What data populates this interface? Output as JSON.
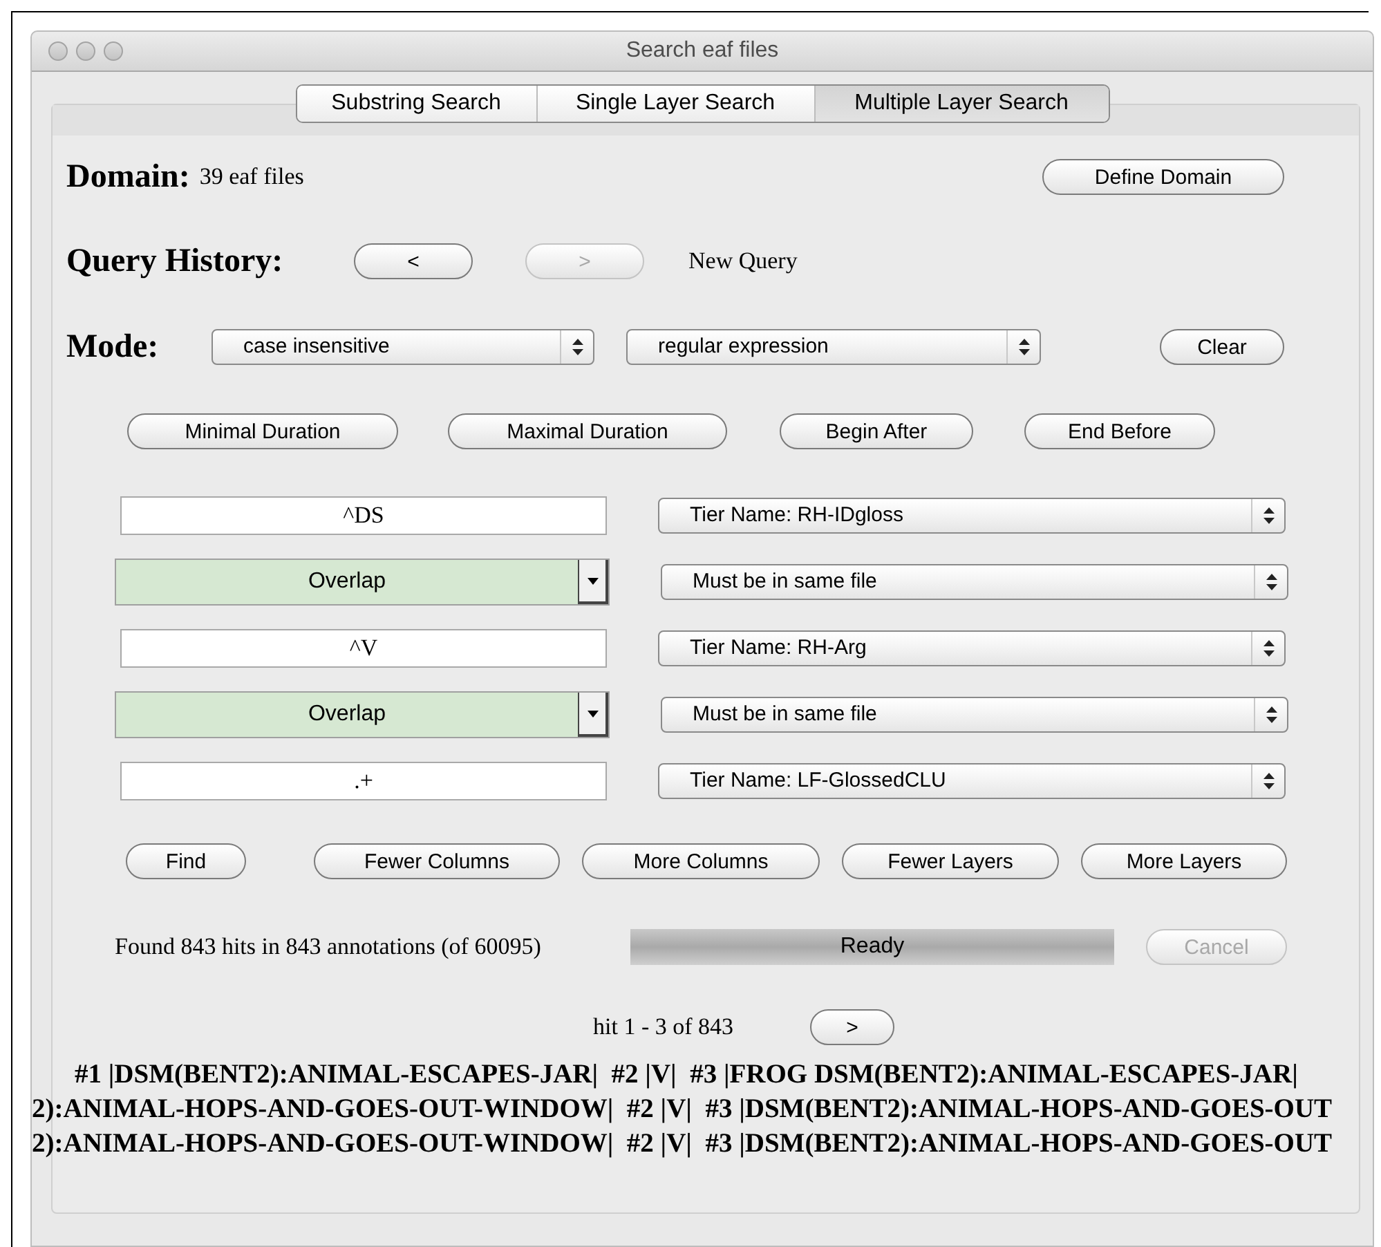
{
  "window": {
    "title": "Search eaf files"
  },
  "tabs": [
    {
      "label": "Substring Search",
      "selected": false
    },
    {
      "label": "Single Layer Search",
      "selected": false
    },
    {
      "label": "Multiple Layer Search",
      "selected": true
    }
  ],
  "domain": {
    "label": "Domain:",
    "value": "39 eaf files",
    "button": "Define Domain"
  },
  "query_history": {
    "label": "Query History:",
    "buttons": [
      {
        "label": "<",
        "disabled": false
      },
      {
        "label": ">",
        "disabled": true
      }
    ],
    "status": "New Query"
  },
  "mode": {
    "label": "Mode:",
    "selects": [
      "case insensitive",
      "regular expression"
    ],
    "button": "Clear"
  },
  "constraint_buttons": [
    "Minimal Duration",
    "Maximal Duration",
    "Begin After",
    "End Before"
  ],
  "layers": [
    {
      "kind": "pattern",
      "left": "^DS",
      "right": "Tier Name: RH-IDgloss"
    },
    {
      "kind": "relation",
      "left": "Overlap",
      "right": "Must be in same file"
    },
    {
      "kind": "pattern",
      "left": "^V",
      "right": "Tier Name: RH-Arg"
    },
    {
      "kind": "relation",
      "left": "Overlap",
      "right": "Must be in same file"
    },
    {
      "kind": "pattern",
      "left": ".+",
      "right": "Tier Name: LF-GlossedCLU"
    }
  ],
  "action_buttons": [
    "Find",
    "Fewer Columns",
    "More Columns",
    "Fewer Layers",
    "More Layers"
  ],
  "status": {
    "text": "Found 843 hits in 843 annotations (of 60095)",
    "progress": {
      "label": "Ready",
      "level": 1
    },
    "cancel": {
      "label": "Cancel",
      "disabled": true
    }
  },
  "pagination": {
    "text": "hit 1 - 3 of 843",
    "next": ">"
  },
  "results": [
    "#1 |DSM(BENT2):ANIMAL-ESCAPES-JAR|  #2 |V|  #3 |FROG DSM(BENT2):ANIMAL-ESCAPES-JAR|",
    "2):ANIMAL-HOPS-AND-GOES-OUT-WINDOW|  #2 |V|  #3 |DSM(BENT2):ANIMAL-HOPS-AND-GOES-OUT",
    "2):ANIMAL-HOPS-AND-GOES-OUT-WINDOW|  #2 |V|  #3 |DSM(BENT2):ANIMAL-HOPS-AND-GOES-OUT"
  ]
}
